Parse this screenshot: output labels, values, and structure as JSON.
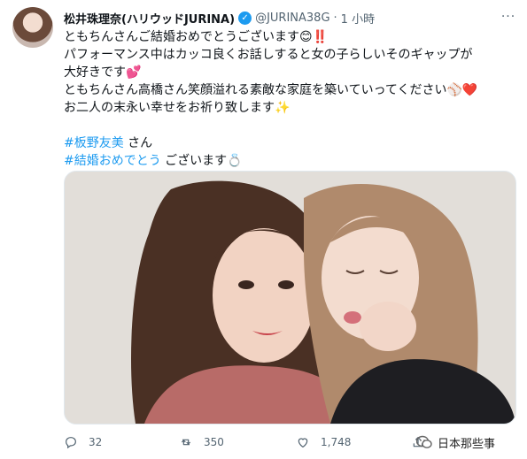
{
  "tweet": {
    "author_name": "松井珠理奈(ハリウッドJURINA)",
    "handle": "@JURINA38G",
    "separator": "·",
    "time": "1 小時",
    "more_label": "···",
    "lines": [
      "ともちんさんご結婚おめでとうございます😊‼️",
      "パフォーマンス中はカッコ良くお話しすると女の子らしいそのギャップが",
      "大好きです💕",
      "ともちんさん高橋さん笑顔溢れる素敵な家庭を築いていってください⚾❤️",
      "お二人の末永い幸せをお祈り致します✨"
    ],
    "hashtag1": "#板野友美",
    "hashtag1_suffix": " さん",
    "hashtag2": "#結婚おめでとう",
    "hashtag2_suffix": " ございます💍"
  },
  "actions": {
    "reply_count": "32",
    "retweet_count": "350",
    "like_count": "1,748"
  },
  "watermark": {
    "text": "日本那些事"
  },
  "colors": {
    "accent": "#1d9bf0",
    "text": "#0f1419",
    "secondary": "#536471",
    "like_red": "#e0245e"
  }
}
